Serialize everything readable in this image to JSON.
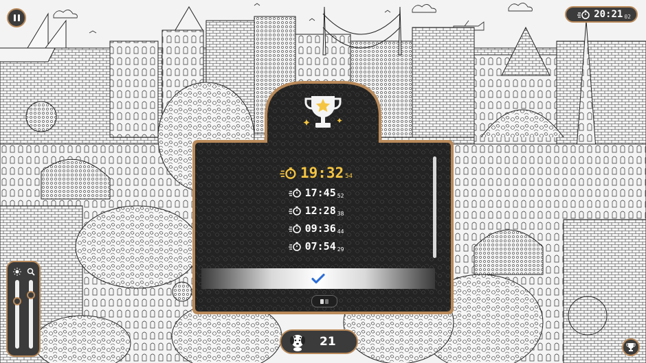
{
  "hud": {
    "timer": {
      "main": "20:21",
      "fraction": "02",
      "icon": "stopwatch-icon"
    },
    "found_count": "21",
    "pause_icon": "pause-icon",
    "trophy_icon": "trophy-icon",
    "brightness_icon": "brightness-icon",
    "zoom_icon": "zoom-icon",
    "brightness_level": 0.72,
    "zoom_level": 0.82
  },
  "results_dialog": {
    "trophy_icon": "trophy-star-icon",
    "best_time": {
      "main": "19:32",
      "fraction": "54"
    },
    "times": [
      {
        "main": "17:45",
        "fraction": "52"
      },
      {
        "main": "12:28",
        "fraction": "38"
      },
      {
        "main": "09:36",
        "fraction": "44"
      },
      {
        "main": "07:54",
        "fraction": "29"
      }
    ],
    "confirm_icon": "checkmark-icon"
  },
  "colors": {
    "accent_border": "#b98a5a",
    "panel_dark": "#2d2d2d",
    "best_time_gold": "#f5c542",
    "confirm_blue": "#2f6fd6",
    "line_art": "#222222"
  }
}
